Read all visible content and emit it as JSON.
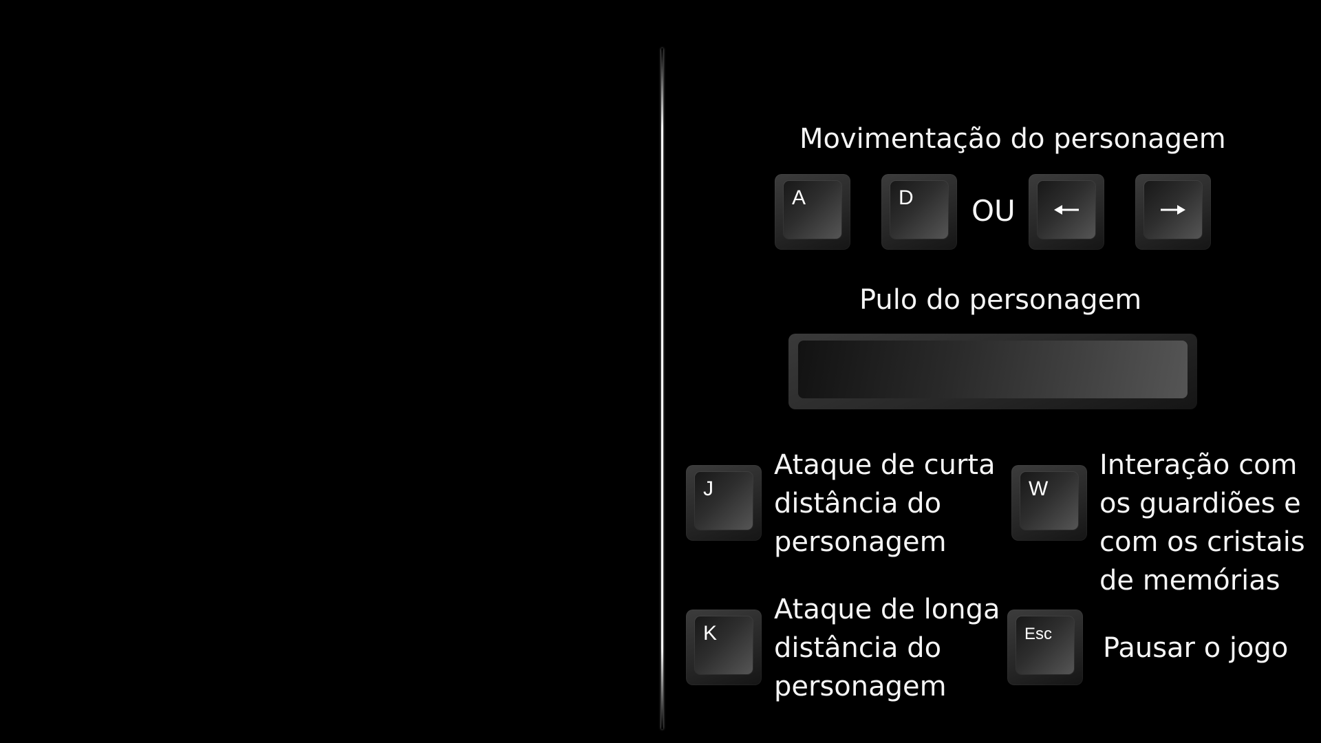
{
  "movement": {
    "title": "Movimentação do personagem",
    "or_label": "OU",
    "keys": [
      {
        "legend": "A",
        "icon": ""
      },
      {
        "legend": "D",
        "icon": ""
      },
      {
        "legend": "",
        "icon": "arrow-left-icon"
      },
      {
        "legend": "",
        "icon": "arrow-right-icon"
      }
    ]
  },
  "jump": {
    "title": "Pulo do personagem",
    "key_icon": "spacebar-key"
  },
  "actions": {
    "short_attack": {
      "key": "J",
      "lines": [
        "Ataque de curta",
        "distância do",
        "personagem"
      ]
    },
    "interaction": {
      "key": "W",
      "lines": [
        "Interação com",
        "os guardiões e",
        "com os cristais",
        "de memórias"
      ]
    },
    "long_attack": {
      "key": "K",
      "lines": [
        "Ataque de longa",
        "distância do",
        "personagem"
      ]
    },
    "pause": {
      "key": "Esc",
      "lines": [
        "Pausar o jogo"
      ]
    }
  },
  "colors": {
    "background": "#000000",
    "text": "#f5f5f5",
    "divider": "#ffffff"
  }
}
